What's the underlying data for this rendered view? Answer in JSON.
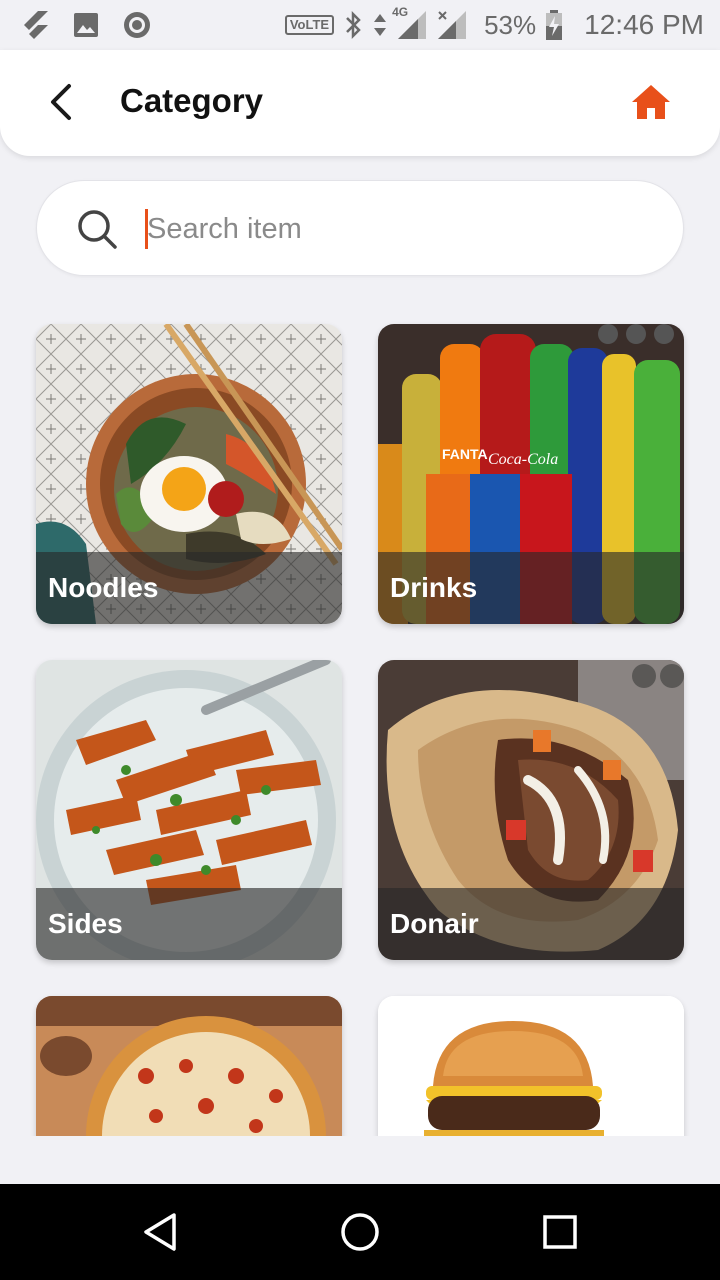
{
  "status_bar": {
    "network_badge": "VoLTE",
    "network_type": "4G",
    "battery_percent": "53%",
    "time": "12:46 PM"
  },
  "header": {
    "title": "Category",
    "back_icon": "back-arrow-icon",
    "home_icon": "home-icon"
  },
  "search": {
    "placeholder": "Search item",
    "value": ""
  },
  "categories": [
    {
      "label": "Noodles",
      "image": "noodle bowl with fried egg and chopsticks"
    },
    {
      "label": "Drinks",
      "image": "bottles and cans of soft drinks"
    },
    {
      "label": "Sides",
      "image": "plate of sweet potato wedges"
    },
    {
      "label": "Donair",
      "image": "donair wrap with meat and sauce"
    },
    {
      "label": "",
      "image": "pizza on wooden board"
    },
    {
      "label": "",
      "image": "cheeseburger"
    }
  ],
  "colors": {
    "accent": "#e8501a",
    "background": "#f1f1f5",
    "header_bg": "#ffffff",
    "label_overlay": "#282828"
  },
  "nav": {
    "back": "triangle-back-icon",
    "home": "circle-home-icon",
    "recents": "square-recents-icon"
  }
}
